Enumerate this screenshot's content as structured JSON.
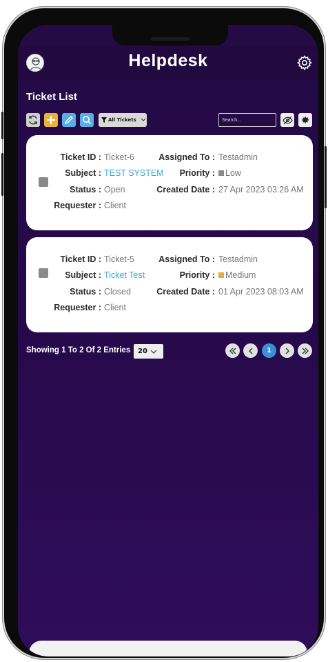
{
  "header": {
    "title": "Helpdesk"
  },
  "page": {
    "subtitle": "Ticket List"
  },
  "toolbar": {
    "filter_label": "All Tickets",
    "search_placeholder": "Search..."
  },
  "labels": {
    "ticket_id": "Ticket ID :",
    "subject": "Subject :",
    "status": "Status :",
    "requester": "Requester :",
    "assigned_to": "Assigned To :",
    "priority": "Priority :",
    "created_date": "Created Date :"
  },
  "tickets": [
    {
      "ticket_id": "Ticket-6",
      "subject": "TEST SYSTEM",
      "status": "Open",
      "requester": "Client",
      "assigned_to": "Testadmin",
      "priority": "Low",
      "priority_color": "#8a8a8a",
      "created_date": "27 Apr 2023 03:26 AM"
    },
    {
      "ticket_id": "Ticket-5",
      "subject": "Ticket Test",
      "status": "Closed",
      "requester": "Client",
      "assigned_to": "Testadmin",
      "priority": "Medium",
      "priority_color": "#e0b13a",
      "created_date": "01 Apr 2023 08:03 AM"
    }
  ],
  "pagination": {
    "showing": "Showing 1 To 2 Of 2 Entries",
    "page_size": "20",
    "current_page": "1"
  },
  "colors": {
    "background": "#26094a",
    "link": "#3aa7d6",
    "add_button": "#e9b23c",
    "tool_button": "#5aaee6",
    "active_page": "#3a8fd8"
  },
  "icons": [
    "refresh-icon",
    "plus-icon",
    "edit-icon",
    "search-icon",
    "filter-icon",
    "eye-off-icon",
    "gear-icon",
    "first-page-icon",
    "prev-page-icon",
    "next-page-icon",
    "last-page-icon"
  ]
}
